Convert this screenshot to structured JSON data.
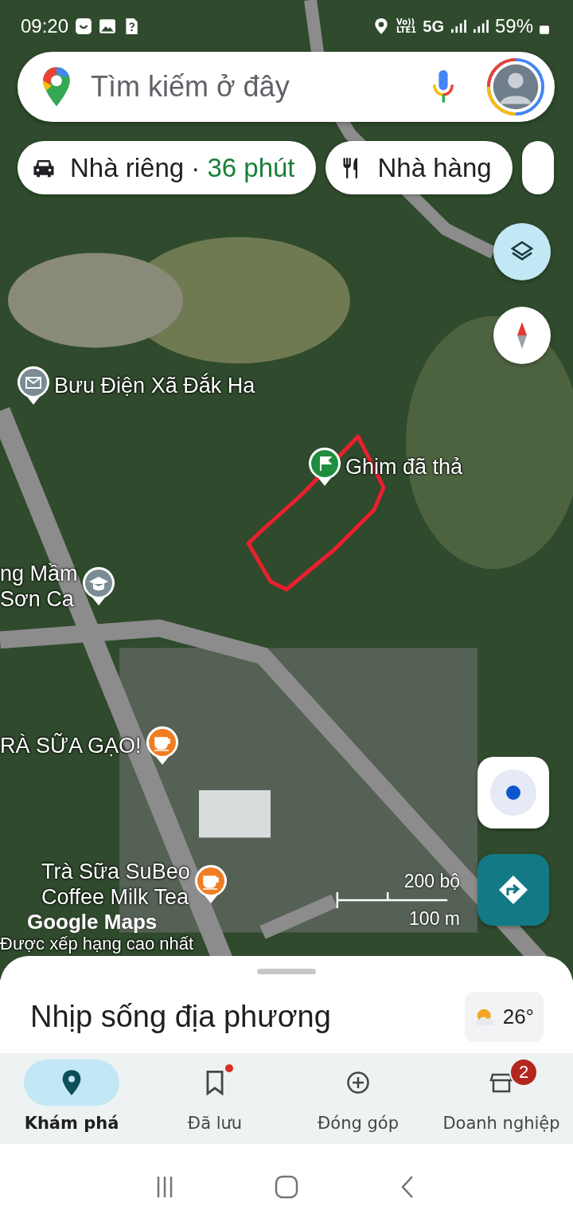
{
  "status_bar": {
    "time": "09:20",
    "volte_top": "Vo))",
    "volte_bottom": "LTE1",
    "network": "5G",
    "battery": "59%"
  },
  "search": {
    "placeholder": "Tìm kiếm ở đây"
  },
  "chips": [
    {
      "kind": "home",
      "label": "Nhà riêng",
      "separator": "·",
      "eta": "36 phút"
    },
    {
      "kind": "restaurant",
      "label": "Nhà hàng"
    }
  ],
  "map": {
    "labels": [
      {
        "kind": "post",
        "lines": [
          "Bưu Điện Xã Đắk Ha"
        ]
      },
      {
        "kind": "dropped-pin",
        "lines": [
          "Ghim đã thả"
        ]
      },
      {
        "kind": "school",
        "lines": [
          "ng Mầm",
          "Sơn Ca"
        ]
      },
      {
        "kind": "cafe",
        "lines": [
          "RÀ SỮA GẠO!"
        ]
      },
      {
        "kind": "cafe",
        "lines": [
          "Trà Sữa SuBeo",
          "Coffee Milk Tea"
        ]
      }
    ],
    "logo": "Google Maps",
    "rating_note": "Được xếp hạng cao nhất",
    "scale_imperial": "200 bộ",
    "scale_metric": "100 m"
  },
  "sheet": {
    "title": "Nhịp sống địa phương",
    "temperature": "26°"
  },
  "nav": [
    {
      "kind": "explore",
      "label": "Khám phá",
      "selected": true
    },
    {
      "kind": "saved",
      "label": "Đã lưu",
      "selected": false,
      "dot": true
    },
    {
      "kind": "contribute",
      "label": "Đóng góp",
      "selected": false
    },
    {
      "kind": "business",
      "label": "Doanh nghiệp",
      "selected": false,
      "badge": "2"
    }
  ]
}
